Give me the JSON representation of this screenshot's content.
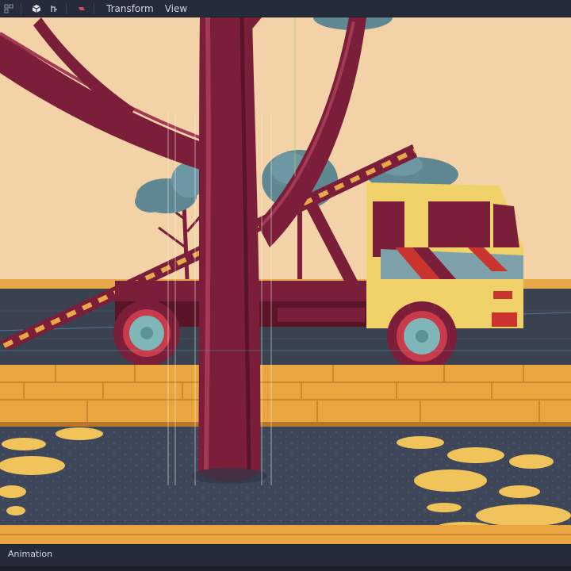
{
  "toolbar": {
    "icons": [
      "grid-snap-icon",
      "cube-icon",
      "skeleton-icon",
      "camera-icon"
    ],
    "menus": [
      {
        "label": "Transform"
      },
      {
        "label": "View"
      }
    ]
  },
  "bottom_panel": {
    "tab_label": "Animation"
  },
  "colors": {
    "sky": "#f2d2a6",
    "tree_trunk": "#7a1e3a",
    "truck_body": "#f1d26a",
    "sidewalk": "#e9a640",
    "road": "#3a4250"
  }
}
